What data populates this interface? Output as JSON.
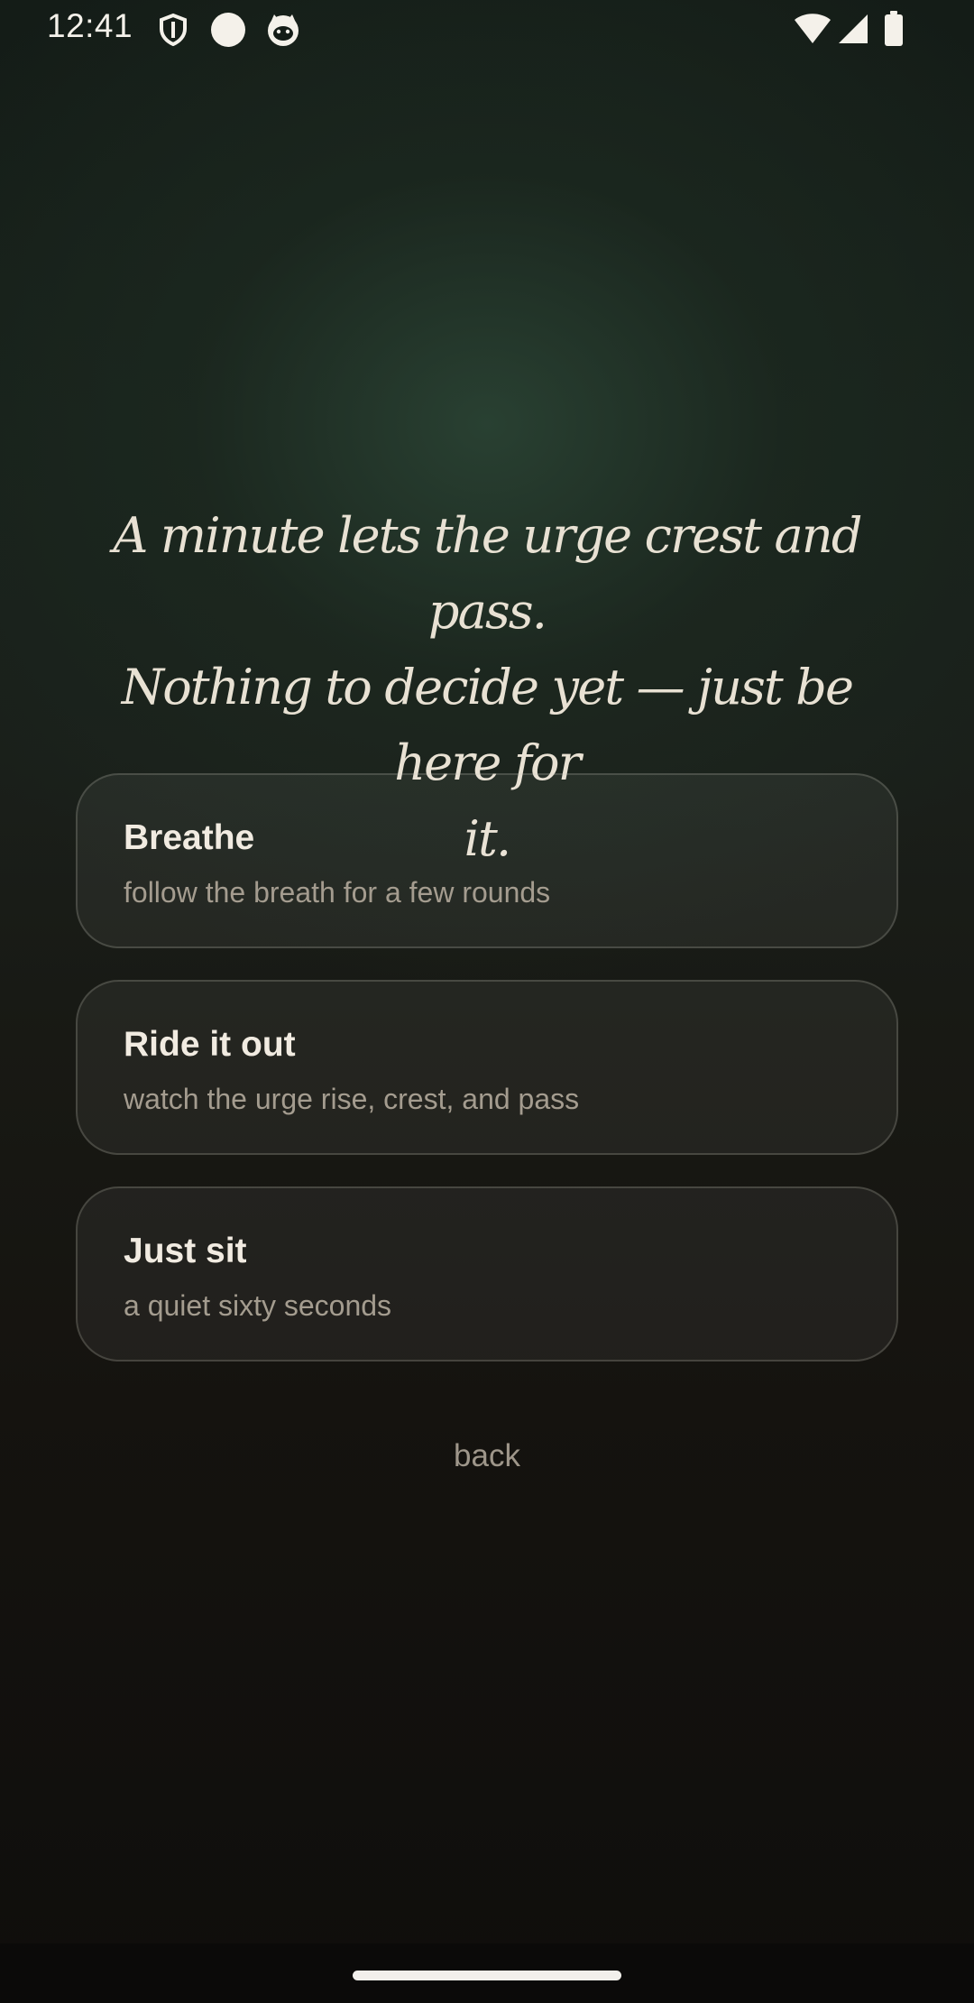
{
  "status_bar": {
    "time": "12:41",
    "left_icons": [
      "shield-icon",
      "circle-icon",
      "cat-face-icon"
    ],
    "right_icons": [
      "wifi-icon",
      "cell-signal-icon",
      "battery-icon"
    ]
  },
  "quote": {
    "line1": "A minute lets the urge crest and pass.",
    "line2": "Nothing to decide yet — just be here for",
    "line3": "it."
  },
  "options": [
    {
      "title": "Breathe",
      "subtitle": "follow the breath for a few rounds"
    },
    {
      "title": "Ride it out",
      "subtitle": "watch the urge rise, crest, and pass"
    },
    {
      "title": "Just sit",
      "subtitle": "a quiet sixty seconds"
    }
  ],
  "back_label": "back",
  "colors": {
    "background_top": "#17201a",
    "background_bottom": "#0f0e0c",
    "text_primary": "#ede6da",
    "text_secondary": "#a49c8f"
  }
}
